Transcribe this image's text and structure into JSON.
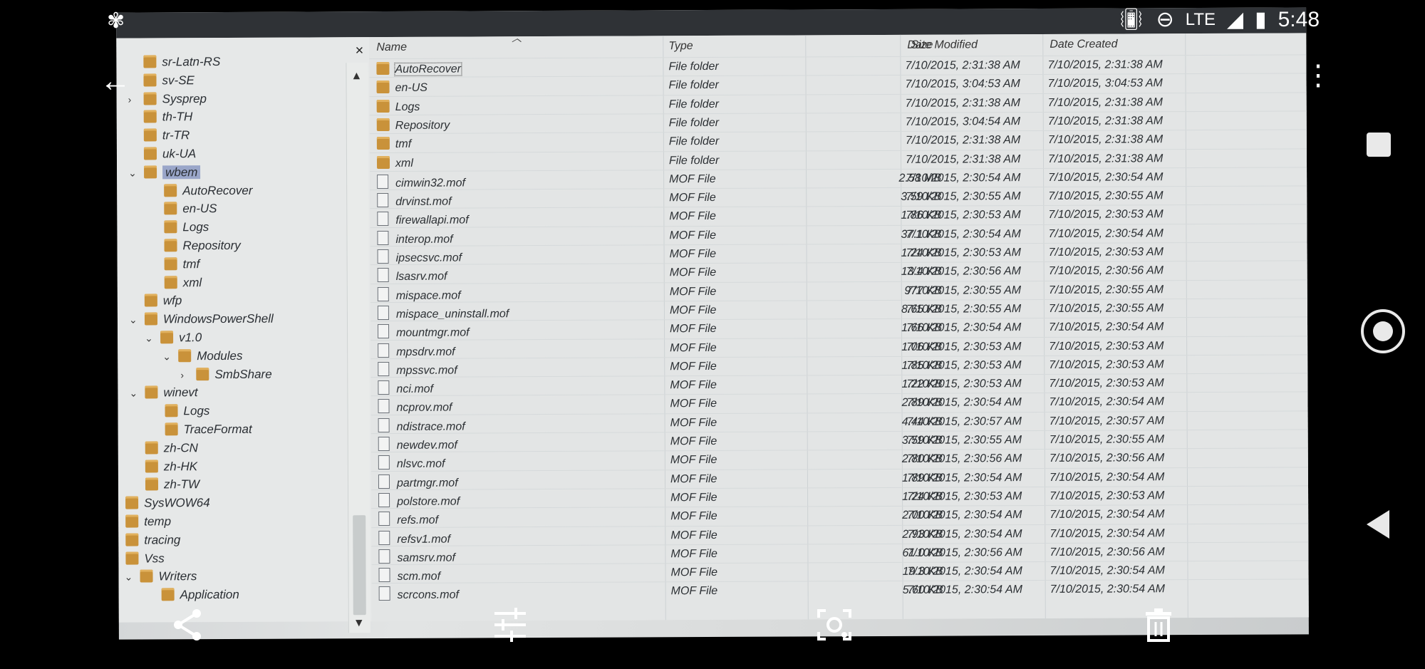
{
  "status_bar": {
    "app_icon": "pinwheel-icon",
    "lte": "LTE",
    "time": "5:48"
  },
  "tree": {
    "close": "×",
    "nodes": [
      {
        "label": "sr-Latn-RS"
      },
      {
        "label": "sv-SE"
      },
      {
        "label": "Sysprep"
      },
      {
        "label": "th-TH"
      },
      {
        "label": "tr-TR"
      },
      {
        "label": "uk-UA"
      },
      {
        "label": "wbem"
      },
      {
        "label": "AutoRecover"
      },
      {
        "label": "en-US"
      },
      {
        "label": "Logs"
      },
      {
        "label": "Repository"
      },
      {
        "label": "tmf"
      },
      {
        "label": "xml"
      },
      {
        "label": "wfp"
      },
      {
        "label": "WindowsPowerShell"
      },
      {
        "label": "v1.0"
      },
      {
        "label": "Modules"
      },
      {
        "label": "SmbShare"
      },
      {
        "label": "winevt"
      },
      {
        "label": "Logs"
      },
      {
        "label": "TraceFormat"
      },
      {
        "label": "zh-CN"
      },
      {
        "label": "zh-HK"
      },
      {
        "label": "zh-TW"
      },
      {
        "label": "SysWOW64"
      },
      {
        "label": "temp"
      },
      {
        "label": "tracing"
      },
      {
        "label": "Vss"
      },
      {
        "label": "Writers"
      },
      {
        "label": "Application"
      }
    ]
  },
  "list": {
    "headers": {
      "name": "Name",
      "type": "Type",
      "size": "Size",
      "modified": "Date Modified",
      "created": "Date Created"
    },
    "rows": [
      {
        "name": "AutoRecover",
        "type": "File folder",
        "size": "",
        "modified": "7/10/2015, 2:31:38 AM",
        "created": "7/10/2015, 2:31:38 AM"
      },
      {
        "name": "en-US",
        "type": "File folder",
        "size": "",
        "modified": "7/10/2015, 3:04:53 AM",
        "created": "7/10/2015, 3:04:53 AM"
      },
      {
        "name": "Logs",
        "type": "File folder",
        "size": "",
        "modified": "7/10/2015, 2:31:38 AM",
        "created": "7/10/2015, 2:31:38 AM"
      },
      {
        "name": "Repository",
        "type": "File folder",
        "size": "",
        "modified": "7/10/2015, 3:04:54 AM",
        "created": "7/10/2015, 2:31:38 AM"
      },
      {
        "name": "tmf",
        "type": "File folder",
        "size": "",
        "modified": "7/10/2015, 2:31:38 AM",
        "created": "7/10/2015, 2:31:38 AM"
      },
      {
        "name": "xml",
        "type": "File folder",
        "size": "",
        "modified": "7/10/2015, 2:31:38 AM",
        "created": "7/10/2015, 2:31:38 AM"
      },
      {
        "name": "cimwin32.mof",
        "type": "MOF File",
        "size": "2.58 MB",
        "modified": "7/10/2015, 2:30:54 AM",
        "created": "7/10/2015, 2:30:54 AM"
      },
      {
        "name": "drvinst.mof",
        "type": "MOF File",
        "size": "3.59 KB",
        "modified": "7/10/2015, 2:30:55 AM",
        "created": "7/10/2015, 2:30:55 AM"
      },
      {
        "name": "firewallapi.mof",
        "type": "MOF File",
        "size": "1.86 KB",
        "modified": "7/10/2015, 2:30:53 AM",
        "created": "7/10/2015, 2:30:53 AM"
      },
      {
        "name": "interop.mof",
        "type": "MOF File",
        "size": "37.1 KB",
        "modified": "7/10/2015, 2:30:54 AM",
        "created": "7/10/2015, 2:30:54 AM"
      },
      {
        "name": "ipsecsvc.mof",
        "type": "MOF File",
        "size": "1.24 KB",
        "modified": "7/10/2015, 2:30:53 AM",
        "created": "7/10/2015, 2:30:53 AM"
      },
      {
        "name": "lsasrv.mof",
        "type": "MOF File",
        "size": "13.4 KB",
        "modified": "7/10/2015, 2:30:56 AM",
        "created": "7/10/2015, 2:30:56 AM"
      },
      {
        "name": "mispace.mof",
        "type": "MOF File",
        "size": "977 KB",
        "modified": "7/10/2015, 2:30:55 AM",
        "created": "7/10/2015, 2:30:55 AM"
      },
      {
        "name": "mispace_uninstall.mof",
        "type": "MOF File",
        "size": "8.65 KB",
        "modified": "7/10/2015, 2:30:55 AM",
        "created": "7/10/2015, 2:30:55 AM"
      },
      {
        "name": "mountmgr.mof",
        "type": "MOF File",
        "size": "1.66 KB",
        "modified": "7/10/2015, 2:30:54 AM",
        "created": "7/10/2015, 2:30:54 AM"
      },
      {
        "name": "mpsdrv.mof",
        "type": "MOF File",
        "size": "1.06 KB",
        "modified": "7/10/2015, 2:30:53 AM",
        "created": "7/10/2015, 2:30:53 AM"
      },
      {
        "name": "mpssvc.mof",
        "type": "MOF File",
        "size": "1.85 KB",
        "modified": "7/10/2015, 2:30:53 AM",
        "created": "7/10/2015, 2:30:53 AM"
      },
      {
        "name": "nci.mof",
        "type": "MOF File",
        "size": "1.22 KB",
        "modified": "7/10/2015, 2:30:53 AM",
        "created": "7/10/2015, 2:30:53 AM"
      },
      {
        "name": "ncprov.mof",
        "type": "MOF File",
        "size": "2.89 KB",
        "modified": "7/10/2015, 2:30:54 AM",
        "created": "7/10/2015, 2:30:54 AM"
      },
      {
        "name": "ndistrace.mof",
        "type": "MOF File",
        "size": "4.44 KB",
        "modified": "7/10/2015, 2:30:57 AM",
        "created": "7/10/2015, 2:30:57 AM"
      },
      {
        "name": "newdev.mof",
        "type": "MOF File",
        "size": "3.59 KB",
        "modified": "7/10/2015, 2:30:55 AM",
        "created": "7/10/2015, 2:30:55 AM"
      },
      {
        "name": "nlsvc.mof",
        "type": "MOF File",
        "size": "2.80 KB",
        "modified": "7/10/2015, 2:30:56 AM",
        "created": "7/10/2015, 2:30:56 AM"
      },
      {
        "name": "partmgr.mof",
        "type": "MOF File",
        "size": "1.89 KB",
        "modified": "7/10/2015, 2:30:54 AM",
        "created": "7/10/2015, 2:30:54 AM"
      },
      {
        "name": "polstore.mof",
        "type": "MOF File",
        "size": "1.24 KB",
        "modified": "7/10/2015, 2:30:53 AM",
        "created": "7/10/2015, 2:30:53 AM"
      },
      {
        "name": "refs.mof",
        "type": "MOF File",
        "size": "2.00 KB",
        "modified": "7/10/2015, 2:30:54 AM",
        "created": "7/10/2015, 2:30:54 AM"
      },
      {
        "name": "refsv1.mof",
        "type": "MOF File",
        "size": "2.93 KB",
        "modified": "7/10/2015, 2:30:54 AM",
        "created": "7/10/2015, 2:30:54 AM"
      },
      {
        "name": "samsrv.mof",
        "type": "MOF File",
        "size": "61.0 KB",
        "modified": "7/10/2015, 2:30:56 AM",
        "created": "7/10/2015, 2:30:56 AM"
      },
      {
        "name": "scm.mof",
        "type": "MOF File",
        "size": "19.3 KB",
        "modified": "7/10/2015, 2:30:54 AM",
        "created": "7/10/2015, 2:30:54 AM"
      },
      {
        "name": "scrcons.mof",
        "type": "MOF File",
        "size": "5.60 KB",
        "modified": "7/10/2015, 2:30:54 AM",
        "created": "7/10/2015, 2:30:54 AM"
      }
    ]
  },
  "viewer_controls": {
    "back_icon": "arrow-left-icon",
    "menu_icon": "more-vert-icon",
    "share_icon": "share-icon",
    "edit_icon": "tune-icon",
    "lens_icon": "lens-icon",
    "delete_icon": "trash-icon"
  }
}
